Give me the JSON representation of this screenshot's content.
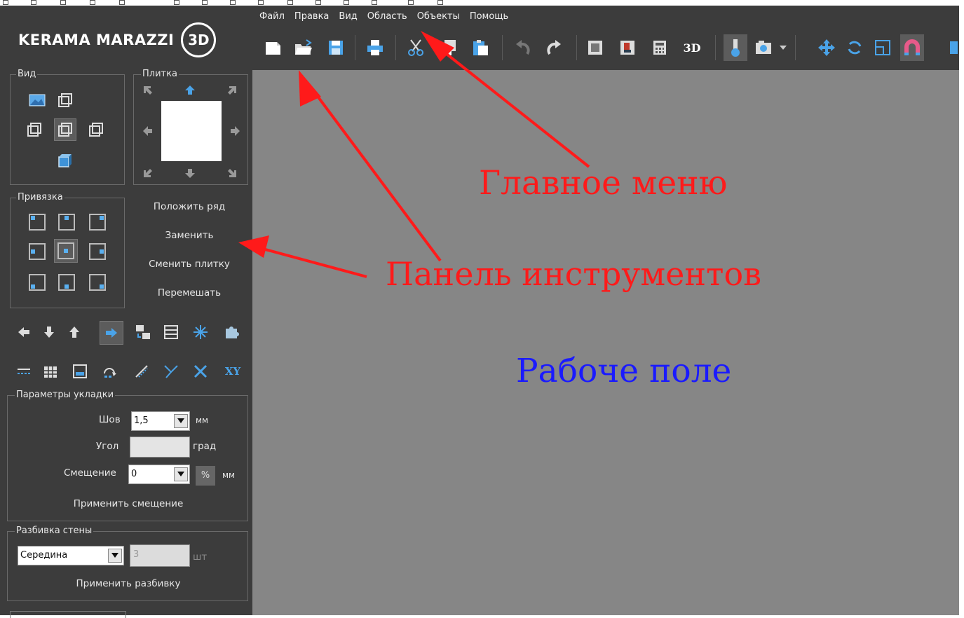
{
  "app": {
    "logo_text": "KERAMA MARAZZI",
    "logo_badge": "3D"
  },
  "menu": [
    "Файл",
    "Правка",
    "Вид",
    "Область",
    "Объекты",
    "Помощь"
  ],
  "toolbar": {
    "btn_3d": "3D",
    "icons": [
      "new-file-icon",
      "open-folder-icon",
      "save-icon",
      "print-icon",
      "cut-icon",
      "copy-icon",
      "paste-icon",
      "undo-icon",
      "redo-icon",
      "frame-icon",
      "furniture-icon",
      "calculator-icon",
      "3d-view-icon",
      "lighting-icon",
      "camera-icon",
      "move-icon",
      "rotate-icon",
      "scale-icon",
      "magnet-icon"
    ]
  },
  "panel": {
    "view_legend": "Вид",
    "tile_legend": "Плитка",
    "snap_legend": "Привязка",
    "actions": [
      "Положить ряд",
      "Заменить",
      "Сменить плитку",
      "Перемешать"
    ],
    "xy_label": "XY",
    "layout_params": {
      "legend": "Параметры укладки",
      "seam_label": "Шов",
      "seam_value": "1,5",
      "seam_unit": "мм",
      "angle_label": "Угол",
      "angle_value": "",
      "angle_unit": "град",
      "offset_label": "Смещение",
      "offset_value": "0",
      "offset_percent": "%",
      "offset_unit": "мм",
      "apply_offset": "Применить смещение"
    },
    "wall_split": {
      "legend": "Разбивка стены",
      "mode": "Середина",
      "count": "3",
      "count_unit": "шт",
      "apply": "Применить разбивку"
    }
  },
  "annotations": {
    "main_menu": "Главное меню",
    "toolbar": "Панель инструментов",
    "workspace": "Рабоче поле"
  },
  "colors": {
    "panel_bg": "#3c3c3c",
    "workspace_bg": "#868686",
    "annotation_red": "#ff1a1a",
    "annotation_blue": "#1a1aff"
  }
}
